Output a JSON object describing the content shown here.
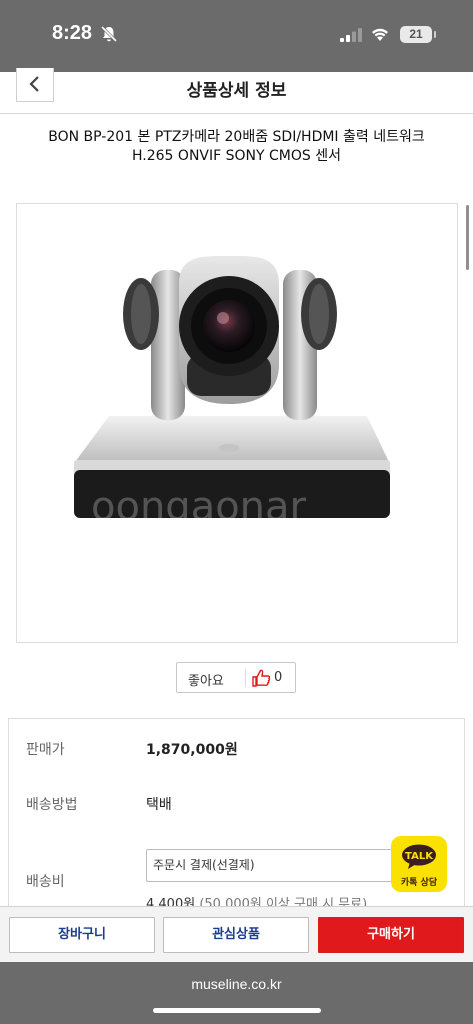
{
  "status_bar": {
    "time": "8:28",
    "battery": "21"
  },
  "header": {
    "title": "상품상세 정보"
  },
  "product": {
    "title_line1": "BON BP-201 본 PTZ카메라 20배줌 SDI/HDMI 출력 네트워크",
    "title_line2": "H.265 ONVIF SONY CMOS 센서",
    "image_watermark": "oongaonar"
  },
  "like": {
    "label": "좋아요",
    "count": "0"
  },
  "info": {
    "price_label": "판매가",
    "price_value": "1,870,000원",
    "shipping_method_label": "배송방법",
    "shipping_method_value": "택배",
    "shipping_fee_label": "배송비",
    "payment_option": "주문시 결제(선결제)",
    "shipping_fee_amount": "4,400원",
    "shipping_fee_note": "(50,000원 이상 구매 시 무료)"
  },
  "kakao": {
    "badge": "TALK",
    "label": "카톡 상담"
  },
  "actions": {
    "cart": "장바구니",
    "wishlist": "관심상품",
    "buy": "구매하기"
  },
  "browser": {
    "url": "museline.co.kr"
  },
  "colors": {
    "buy_button": "#e0191d",
    "kakao": "#fae100",
    "action_text": "#1a3d8f",
    "system_bar": "#6b6b6b"
  }
}
